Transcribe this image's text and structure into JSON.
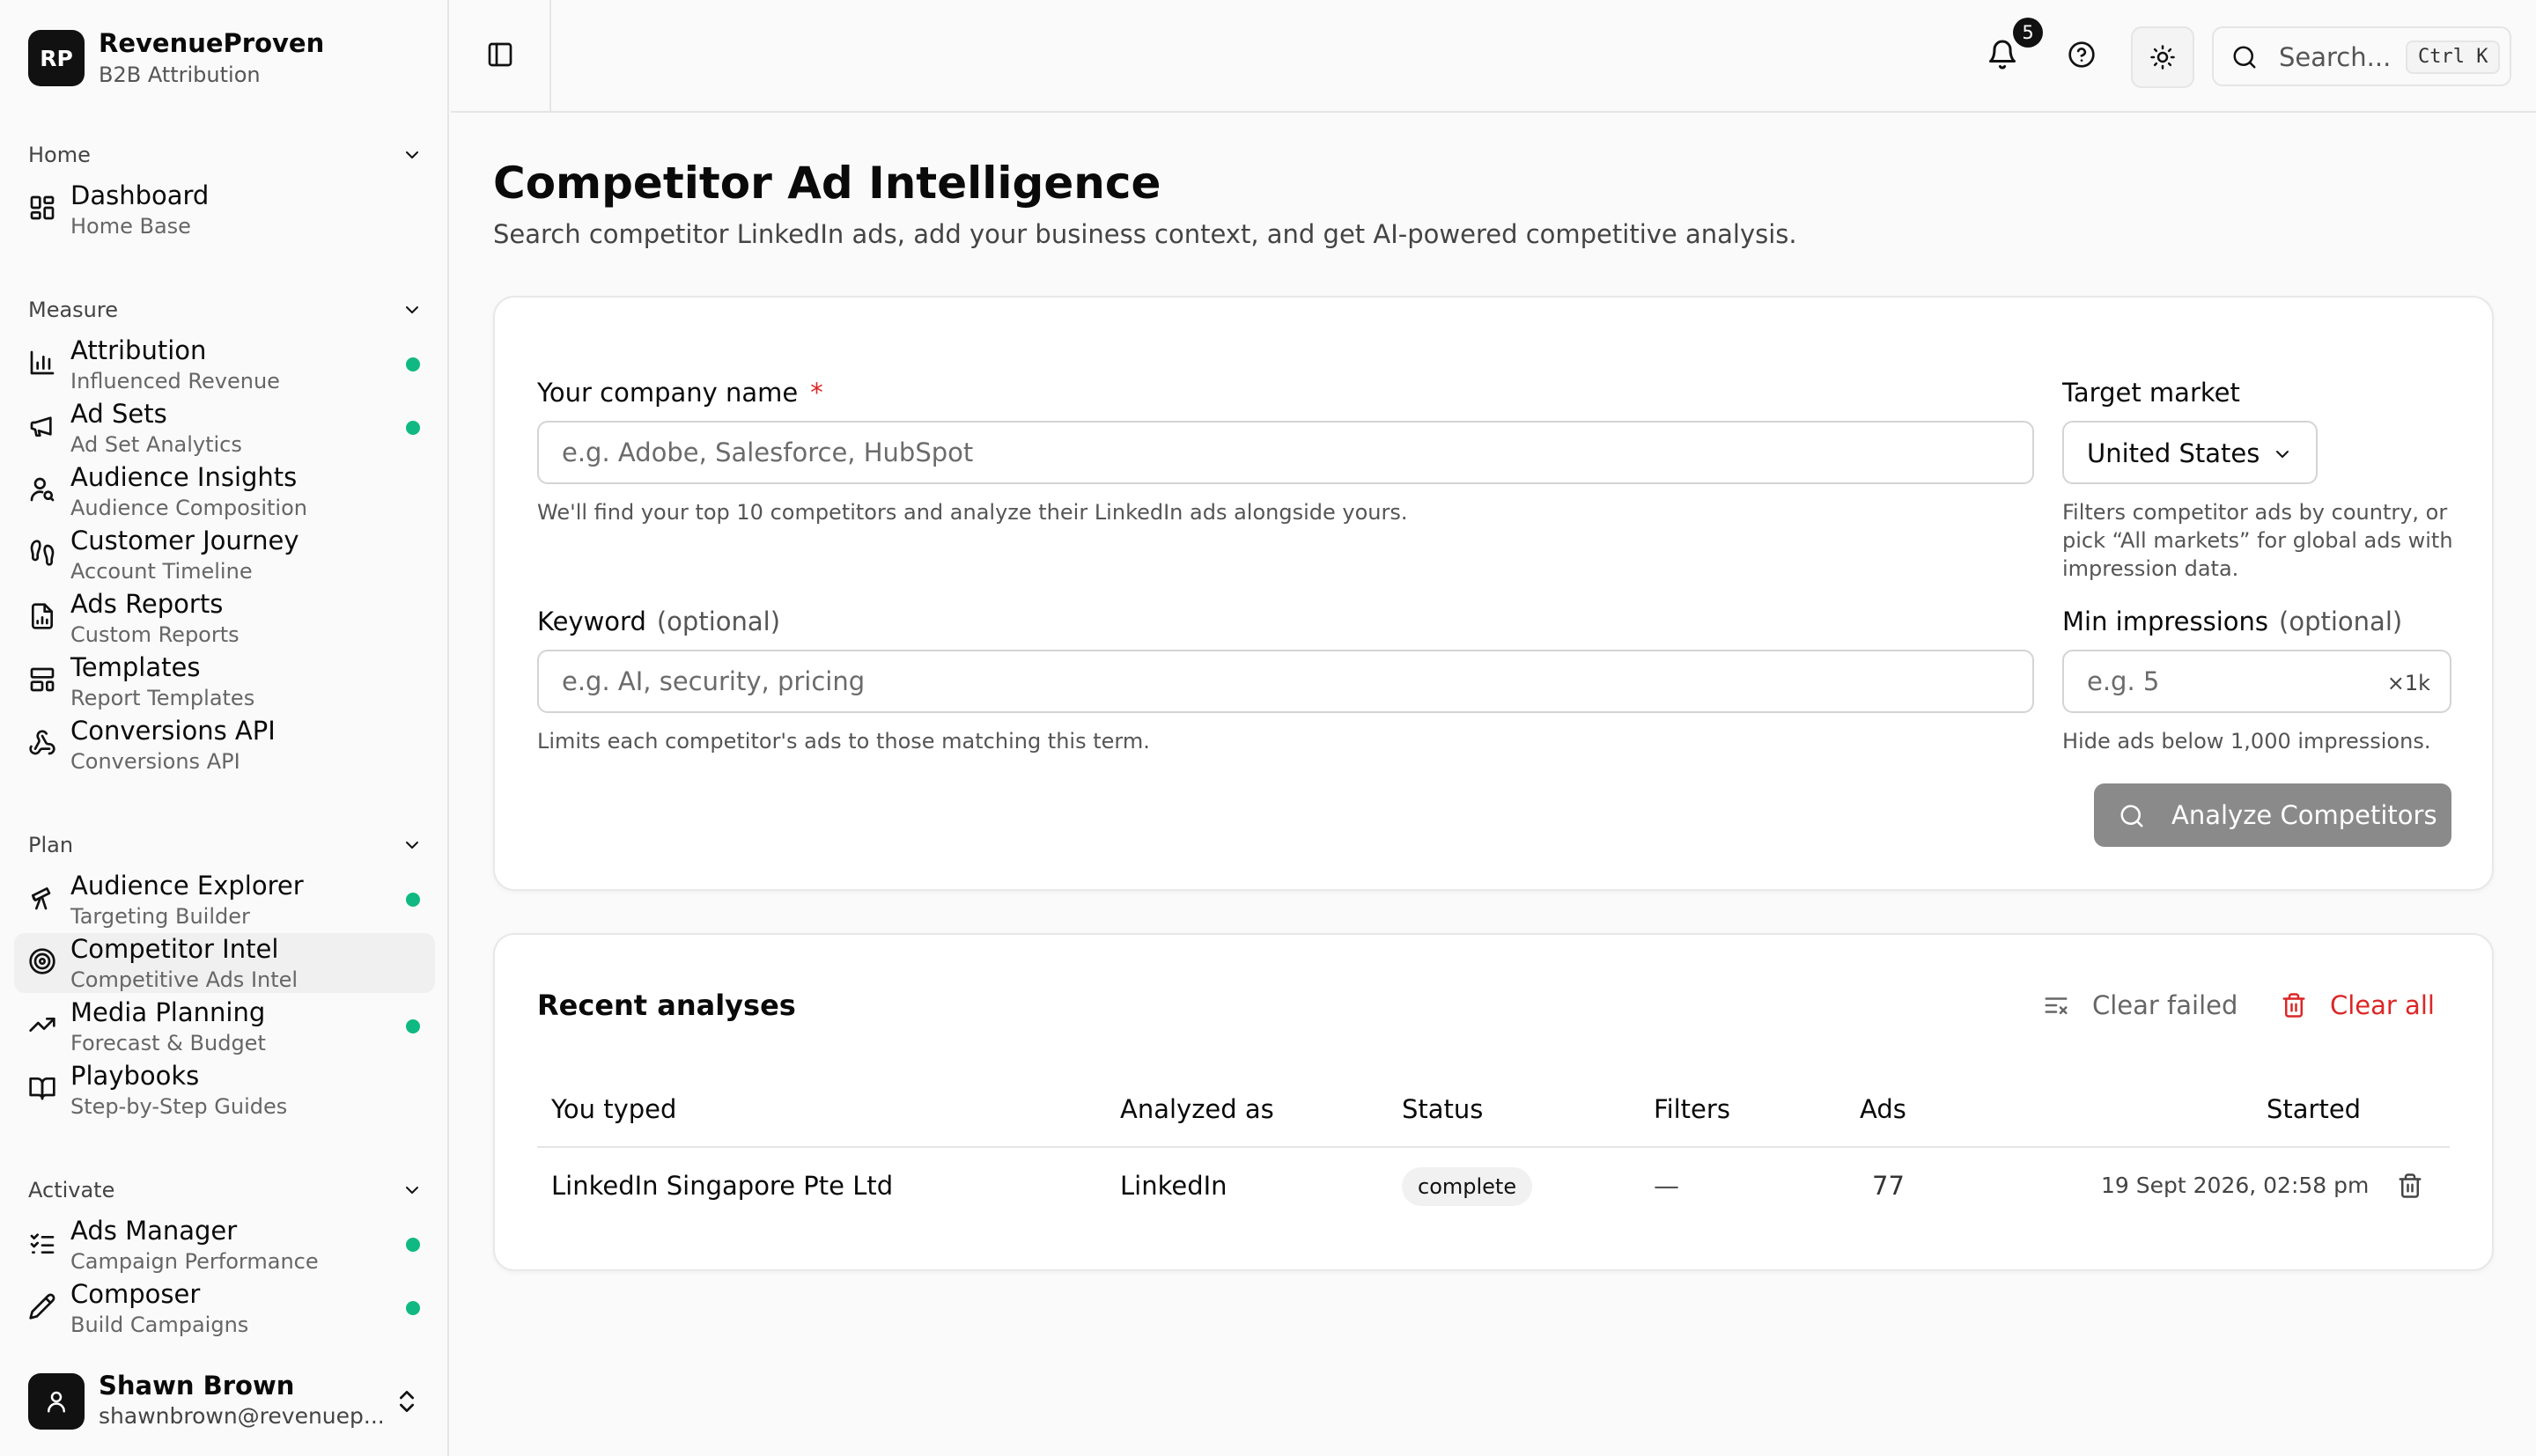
{
  "brand": {
    "logo": "RP",
    "name": "RevenueProven",
    "subtitle": "B2B Attribution"
  },
  "sidebar": {
    "groups": [
      {
        "label": "Home",
        "items": [
          {
            "title": "Dashboard",
            "subtitle": "Home Base",
            "icon": "grid-icon",
            "dot": false
          }
        ]
      },
      {
        "label": "Measure",
        "items": [
          {
            "title": "Attribution",
            "subtitle": "Influenced Revenue",
            "icon": "bar-chart-icon",
            "dot": true
          },
          {
            "title": "Ad Sets",
            "subtitle": "Ad Set Analytics",
            "icon": "megaphone-icon",
            "dot": true
          },
          {
            "title": "Audience Insights",
            "subtitle": "Audience Composition",
            "icon": "user-search-icon",
            "dot": false
          },
          {
            "title": "Customer Journey",
            "subtitle": "Account Timeline",
            "icon": "footprints-icon",
            "dot": false
          },
          {
            "title": "Ads Reports",
            "subtitle": "Custom Reports",
            "icon": "file-chart-icon",
            "dot": false
          },
          {
            "title": "Templates",
            "subtitle": "Report Templates",
            "icon": "layout-template-icon",
            "dot": false
          },
          {
            "title": "Conversions API",
            "subtitle": "Conversions API",
            "icon": "webhook-icon",
            "dot": false
          }
        ]
      },
      {
        "label": "Plan",
        "items": [
          {
            "title": "Audience Explorer",
            "subtitle": "Targeting Builder",
            "icon": "telescope-icon",
            "dot": true
          },
          {
            "title": "Competitor Intel",
            "subtitle": "Competitive Ads Intel",
            "icon": "target-icon",
            "dot": false,
            "active": true
          },
          {
            "title": "Media Planning",
            "subtitle": "Forecast & Budget",
            "icon": "trending-up-icon",
            "dot": true
          },
          {
            "title": "Playbooks",
            "subtitle": "Step-by-Step Guides",
            "icon": "book-open-icon",
            "dot": false
          }
        ]
      },
      {
        "label": "Activate",
        "items": [
          {
            "title": "Ads Manager",
            "subtitle": "Campaign Performance",
            "icon": "list-checks-icon",
            "dot": true
          },
          {
            "title": "Composer",
            "subtitle": "Build Campaigns",
            "icon": "pencil-icon",
            "dot": true
          }
        ]
      }
    ],
    "dot_color": "#10b981"
  },
  "user": {
    "name": "Shawn Brown",
    "email": "shawnbrown@revenuep..."
  },
  "topbar": {
    "notifications": "5",
    "search_placeholder": "Search...",
    "search_shortcut": "Ctrl K"
  },
  "page": {
    "title": "Competitor Ad Intelligence",
    "subtitle": "Search competitor LinkedIn ads, add your business context, and get AI-powered competitive analysis."
  },
  "form": {
    "company_label": "Your company name",
    "company_required": "*",
    "company_placeholder": "e.g. Adobe, Salesforce, HubSpot",
    "company_help": "We'll find your top 10 competitors and analyze their LinkedIn ads alongside yours.",
    "market_label": "Target market",
    "market_value": "United States",
    "market_help": "Filters competitor ads by country, or pick “All markets” for global ads with impression data.",
    "keyword_label": "Keyword",
    "keyword_optional": "(optional)",
    "keyword_placeholder": "e.g. AI, security, pricing",
    "keyword_help": "Limits each competitor's ads to those matching this term.",
    "impressions_label": "Min impressions",
    "impressions_optional": "(optional)",
    "impressions_placeholder": "e.g. 5",
    "impressions_suffix": "×1k",
    "impressions_help": "Hide ads below 1,000 impressions.",
    "analyze_button": "Analyze Competitors"
  },
  "recent": {
    "title": "Recent analyses",
    "clear_failed": "Clear failed",
    "clear_all": "Clear all",
    "clear_all_color": "#dc2626",
    "columns": [
      "You typed",
      "Analyzed as",
      "Status",
      "Filters",
      "Ads",
      "Started"
    ],
    "rows": [
      {
        "typed": "LinkedIn Singapore Pte Ltd",
        "analyzed": "LinkedIn",
        "status": "complete",
        "filters": "—",
        "ads": "77",
        "started": "19 Sept 2026, 02:58 pm"
      }
    ]
  }
}
